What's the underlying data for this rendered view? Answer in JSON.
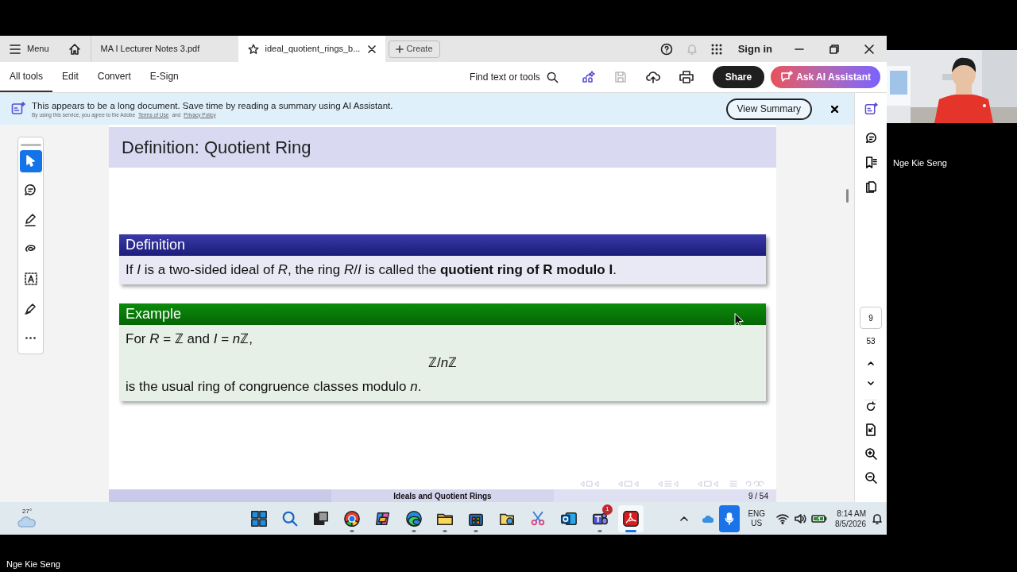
{
  "app_tabs": {
    "menu": "Menu",
    "tabs": [
      {
        "label": "MA I Lecturer Notes 3.pdf",
        "selected": false,
        "starred": false
      },
      {
        "label": "ideal_quotient_rings_b...",
        "selected": true,
        "starred": true
      }
    ],
    "create": "Create",
    "sign_in": "Sign in"
  },
  "toolbar": {
    "tabs": [
      {
        "label": "All tools",
        "selected": true
      },
      {
        "label": "Edit",
        "selected": false
      },
      {
        "label": "Convert",
        "selected": false
      },
      {
        "label": "E-Sign",
        "selected": false
      }
    ],
    "find": "Find text or tools",
    "share": "Share",
    "ai_assistant": "Ask AI Assistant"
  },
  "banner": {
    "message": "This appears to be a long document. Save time by reading a summary using AI Assistant.",
    "legal": "By using this service, you agree to the Adobe",
    "terms": "Terms of Use",
    "and": "and",
    "privacy": "Privacy Policy",
    "button": "View Summary"
  },
  "tools": [
    {
      "kind": "select",
      "selected": true
    },
    {
      "kind": "comment",
      "selected": false
    },
    {
      "kind": "highlight",
      "selected": false
    },
    {
      "kind": "draw",
      "selected": false
    },
    {
      "kind": "text",
      "selected": false
    },
    {
      "kind": "sign",
      "selected": false
    },
    {
      "kind": "more",
      "selected": false
    }
  ],
  "slide": {
    "title": "Definition: Quotient Ring",
    "blocks": [
      {
        "kind": "definition",
        "title": "Definition",
        "lines": [
          {
            "kind": "text",
            "text": "If *I* is a two-sided ideal of *R*, the ring *R*/*I* is called the **quotient ring of R modulo I**."
          }
        ]
      },
      {
        "kind": "example",
        "title": "Example",
        "lines": [
          {
            "kind": "text",
            "parts": [
              "For ",
              "R",
              " = ℤ and ",
              "I",
              " = ",
              "n",
              "ℤ,"
            ]
          },
          {
            "kind": "display",
            "parts": [
              "ℤ/",
              "n",
              "ℤ"
            ]
          },
          {
            "kind": "text",
            "text": "is the usual ring of congruence classes modulo *n*."
          }
        ]
      }
    ],
    "footer": "Ideals and Quotient Rings",
    "page": "9 / 54"
  },
  "page_nav": {
    "current": "9",
    "total": "53"
  },
  "taskbar": {
    "weather": "27°",
    "apps": [
      {
        "kind": "windows",
        "running": false,
        "selected": false
      },
      {
        "kind": "search",
        "running": false,
        "selected": false
      },
      {
        "kind": "taskview",
        "running": false,
        "selected": false
      },
      {
        "kind": "chrome",
        "running": true,
        "selected": false
      },
      {
        "kind": "copilot",
        "running": false,
        "selected": false
      },
      {
        "kind": "edge",
        "running": true,
        "selected": false
      },
      {
        "kind": "folder",
        "running": true,
        "selected": false
      },
      {
        "kind": "store",
        "running": true,
        "selected": false
      },
      {
        "kind": "photos",
        "running": false,
        "selected": false
      },
      {
        "kind": "snip",
        "running": false,
        "selected": false
      },
      {
        "kind": "outlook",
        "running": false,
        "selected": false
      },
      {
        "kind": "teams",
        "running": true,
        "selected": false,
        "badge": "1"
      },
      {
        "kind": "acrobat",
        "running": true,
        "selected": true
      }
    ],
    "language": "ENG",
    "region": "US",
    "time": "8:14 AM",
    "date": "8/5/2026"
  },
  "participant": {
    "name_side": "Nge Kie Seng",
    "name_bottom": "Nge Kie Seng"
  }
}
